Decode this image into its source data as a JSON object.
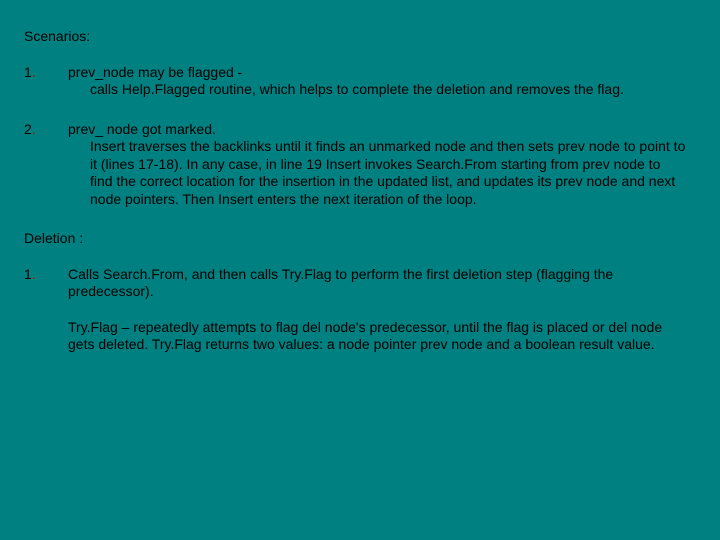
{
  "scenarios_heading": "Scenarios:",
  "sc1": {
    "num": "1",
    "lead": "prev_node may be flagged -",
    "sub": "calls Help.Flagged routine, which helps to complete the deletion and removes the flag."
  },
  "sc2": {
    "num": "2",
    "lead": " prev_ node got marked.",
    "sub": "Insert traverses the backlinks until it finds an unmarked node and then sets prev node to point to it (lines 17-18). In any case, in line 19 Insert invokes Search.From starting from prev node to find the correct location for the insertion in the updated list, and updates its prev node and next node pointers. Then Insert enters the next iteration of the loop."
  },
  "deletion_heading": "Deletion :",
  "del1": {
    "num": "1",
    "p1": "Calls Search.From, and then calls Try.Flag to perform the first deletion step (flagging the predecessor).",
    "p2": "Try.Flag – repeatedly attempts to flag del node's predecessor, until the flag is placed or del node gets deleted. Try.Flag returns two values: a node pointer prev node and a boolean result value."
  }
}
